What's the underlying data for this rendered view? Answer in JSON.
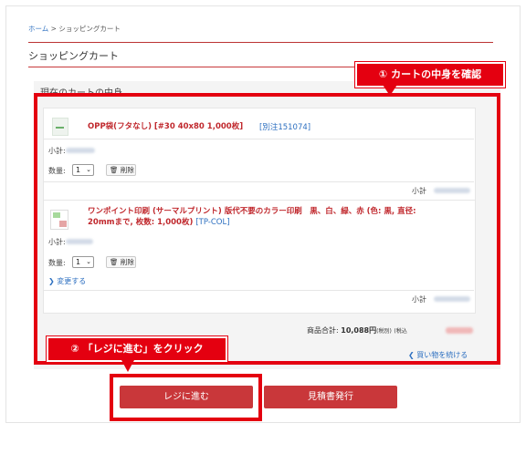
{
  "breadcrumb": {
    "home": "ホーム",
    "separator": " > ",
    "current": "ショッピングカート"
  },
  "page_title": "ショッピングカート",
  "section_title": "現在のカートの中身",
  "items": [
    {
      "name": "OPP袋(フタなし) [#30 40x80 1,000枚]",
      "code": "[別注151074]",
      "subtotal_label": "小計:",
      "qty_label": "数量:",
      "qty_value": "1",
      "delete_label": "削除",
      "line_subtotal_label": "小計"
    },
    {
      "name_line1": "ワンポイント印刷 (サーマルプリント) 版代不要のカラー印刷　黒、白、緑、赤 (色: 黒, 直径:",
      "name_line2": "20mmまで, 枚数: 1,000枚)",
      "code": "[TP-COL]",
      "subtotal_label": "小計:",
      "qty_label": "数量:",
      "qty_value": "1",
      "delete_label": "削除",
      "change_label": "変更する",
      "line_subtotal_label": "小計"
    }
  ],
  "totals": {
    "label": "商品合計:",
    "value": "10,088円",
    "tax_excluded": "(税別)",
    "tax_included": "(税込"
  },
  "continue_link": "買い物を続ける",
  "buttons": {
    "checkout": "レジに進む",
    "estimate": "見積書発行"
  },
  "callouts": {
    "step1": "① カートの中身を確認",
    "step2": "② 「レジに進む」をクリック"
  },
  "colors": {
    "accent_red": "#e40010",
    "button_red": "#c9373a",
    "link_blue": "#2c6fc0"
  }
}
